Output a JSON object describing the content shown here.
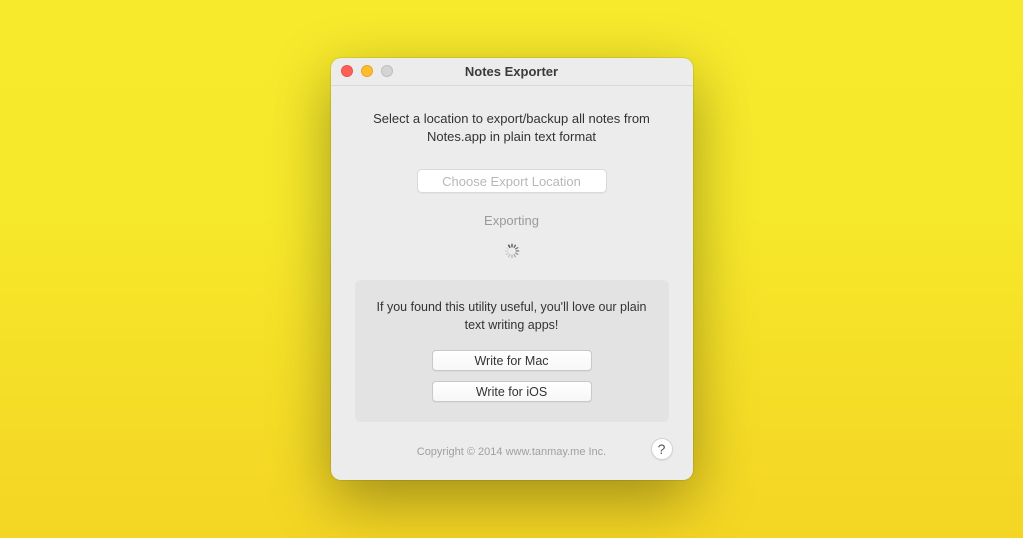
{
  "window": {
    "title": "Notes Exporter"
  },
  "main": {
    "instruction": "Select a location to export/backup all notes from Notes.app in plain text format",
    "choose_button": "Choose Export Location",
    "status": "Exporting"
  },
  "promo": {
    "text": "If you found this utility useful, you'll love our plain text writing apps!",
    "mac_button": "Write for Mac",
    "ios_button": "Write for iOS"
  },
  "footer": {
    "copyright": "Copyright © 2014 www.tanmay.me Inc.",
    "help": "?"
  }
}
